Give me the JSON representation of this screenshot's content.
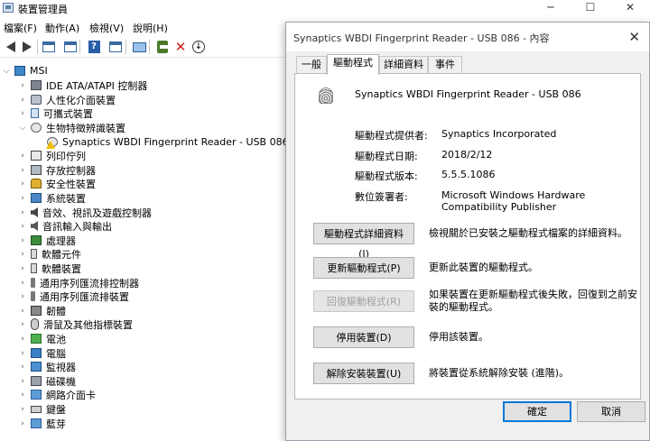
{
  "main_window": {
    "title": "裝置管理員",
    "controls": {
      "minimize": "─",
      "maximize": "☐",
      "close": "✕"
    },
    "menu": [
      "檔案(F)",
      "動作(A)",
      "檢視(V)",
      "說明(H)"
    ],
    "toolbar": [
      "back-icon",
      "forward-icon",
      "console-tree-icon",
      "properties-icon",
      "help-icon",
      "scan-icon",
      "update-driver-icon",
      "uninstall-icon",
      "disable-icon"
    ]
  },
  "tree": {
    "root": "MSI",
    "items": [
      {
        "label": "IDE ATA/ATAPI 控制器",
        "icon": "disk-controller-icon",
        "expanded": false
      },
      {
        "label": "人性化介面裝置",
        "icon": "hid-icon",
        "expanded": false
      },
      {
        "label": "可攜式裝置",
        "icon": "portable-device-icon",
        "expanded": false
      },
      {
        "label": "生物特徵辨識裝置",
        "icon": "biometric-icon",
        "expanded": true
      },
      {
        "label": "Synaptics WBDI Fingerprint Reader - USB 086",
        "icon": "fingerprint-warning-icon",
        "child": true
      },
      {
        "label": "列印佇列",
        "icon": "printer-icon",
        "expanded": false
      },
      {
        "label": "存放控制器",
        "icon": "storage-controller-icon",
        "expanded": false
      },
      {
        "label": "安全性裝置",
        "icon": "security-device-icon",
        "expanded": false
      },
      {
        "label": "系統裝置",
        "icon": "system-device-icon",
        "expanded": false
      },
      {
        "label": "音效、視訊及遊戲控制器",
        "icon": "sound-icon",
        "expanded": false
      },
      {
        "label": "音訊輸入與輸出",
        "icon": "audio-io-icon",
        "expanded": false
      },
      {
        "label": "處理器",
        "icon": "processor-icon",
        "expanded": false
      },
      {
        "label": "軟體元件",
        "icon": "software-component-icon",
        "expanded": false
      },
      {
        "label": "軟體裝置",
        "icon": "software-device-icon",
        "expanded": false
      },
      {
        "label": "通用序列匯流排控制器",
        "icon": "usb-controller-icon",
        "expanded": false
      },
      {
        "label": "通用序列匯流排裝置",
        "icon": "usb-device-icon",
        "expanded": false
      },
      {
        "label": "韌體",
        "icon": "firmware-icon",
        "expanded": false
      },
      {
        "label": "滑鼠及其他指標裝置",
        "icon": "mouse-icon",
        "expanded": false
      },
      {
        "label": "電池",
        "icon": "battery-icon",
        "expanded": false
      },
      {
        "label": "電腦",
        "icon": "computer-icon",
        "expanded": false
      },
      {
        "label": "監視器",
        "icon": "monitor-icon",
        "expanded": false
      },
      {
        "label": "磁碟機",
        "icon": "disk-drive-icon",
        "expanded": false
      },
      {
        "label": "網路介面卡",
        "icon": "network-adapter-icon",
        "expanded": false
      },
      {
        "label": "鍵盤",
        "icon": "keyboard-icon",
        "expanded": false
      },
      {
        "label": "藍芽",
        "icon": "bluetooth-icon",
        "expanded": false
      }
    ]
  },
  "dialog": {
    "title": "Synaptics WBDI Fingerprint Reader - USB 086 - 內容",
    "close": "✕",
    "tabs": [
      "一般",
      "驅動程式",
      "詳細資料",
      "事件"
    ],
    "active_tab": "驅動程式",
    "device_name": "Synaptics WBDI Fingerprint Reader - USB 086",
    "properties": [
      {
        "label": "驅動程式提供者:",
        "value": "Synaptics Incorporated"
      },
      {
        "label": "驅動程式日期:",
        "value": "2018/2/12"
      },
      {
        "label": "驅動程式版本:",
        "value": "5.5.5.1086"
      },
      {
        "label": "數位簽署者:",
        "value": "Microsoft Windows Hardware Compatibility Publisher"
      }
    ],
    "actions": [
      {
        "button": "驅動程式詳細資料(I)",
        "description": "檢視關於已安裝之驅動程式檔案的詳細資料。",
        "enabled": true
      },
      {
        "button": "更新驅動程式(P)",
        "description": "更新此裝置的驅動程式。",
        "enabled": true
      },
      {
        "button": "回復驅動程式(R)",
        "description": "如果裝置在更新驅動程式後失敗，回復到之前安裝的驅動程式。",
        "enabled": false
      },
      {
        "button": "停用裝置(D)",
        "description": "停用該裝置。",
        "enabled": true
      },
      {
        "button": "解除安裝裝置(U)",
        "description": "將裝置從系統解除安裝 (進階)。",
        "enabled": true
      }
    ],
    "ok": "確定",
    "cancel": "取消"
  }
}
